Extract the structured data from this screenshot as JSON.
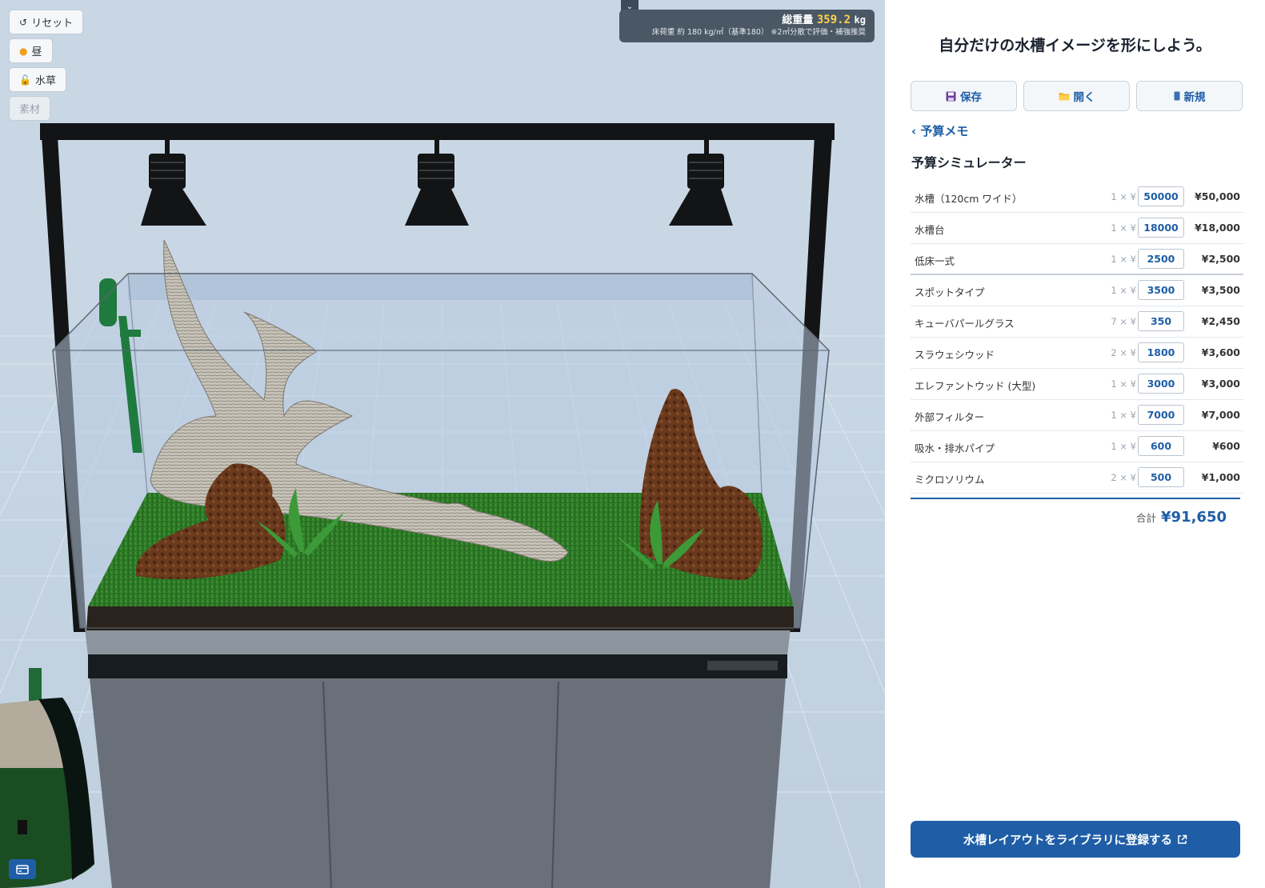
{
  "viewport": {
    "buttons": {
      "reset": "リセット",
      "day": "昼",
      "plants": "水草",
      "material": "素材"
    },
    "weight": {
      "label": "総重量",
      "value": "359.2",
      "unit": "kg",
      "floor_note": "床荷重 約 180 kg/㎡（基準180） ※2㎡分散で評価・補強推奨"
    }
  },
  "sidebar": {
    "title": "自分だけの水槽イメージを形にしよう。",
    "actions": {
      "save": "保存",
      "open": "開く",
      "new": "新規"
    },
    "back_link": "‹ 予算メモ",
    "simulator_title": "予算シミュレーター",
    "items": [
      {
        "name": "水槽（120cm ワイド）",
        "qty": "1 × ¥",
        "unit_price": "50000",
        "subtotal": "¥50,000"
      },
      {
        "name": "水槽台",
        "qty": "1 × ¥",
        "unit_price": "18000",
        "subtotal": "¥18,000"
      },
      {
        "name": "低床一式",
        "qty": "1 × ¥",
        "unit_price": "2500",
        "subtotal": "¥2,500"
      },
      {
        "name": "スポットタイプ",
        "qty": "1 × ¥",
        "unit_price": "3500",
        "subtotal": "¥3,500"
      },
      {
        "name": "キューバパールグラス",
        "qty": "7 × ¥",
        "unit_price": "350",
        "subtotal": "¥2,450"
      },
      {
        "name": "スラウェシウッド",
        "qty": "2 × ¥",
        "unit_price": "1800",
        "subtotal": "¥3,600"
      },
      {
        "name": "エレファントウッド (大型)",
        "qty": "1 × ¥",
        "unit_price": "3000",
        "subtotal": "¥3,000"
      },
      {
        "name": "外部フィルター",
        "qty": "1 × ¥",
        "unit_price": "7000",
        "subtotal": "¥7,000"
      },
      {
        "name": "吸水・排水パイプ",
        "qty": "1 × ¥",
        "unit_price": "600",
        "subtotal": "¥600"
      },
      {
        "name": "ミクロソリウム",
        "qty": "2 × ¥",
        "unit_price": "500",
        "subtotal": "¥1,000"
      }
    ],
    "total_label": "合計",
    "total_value": "¥91,650",
    "register_button": "水槽レイアウトをライブラリに登録する"
  },
  "colors": {
    "accent": "#1f5ea6",
    "weight_value": "#ffd24a",
    "viewport_bg": "#c9d7e5",
    "substrate_moss": "#2f7d28"
  }
}
